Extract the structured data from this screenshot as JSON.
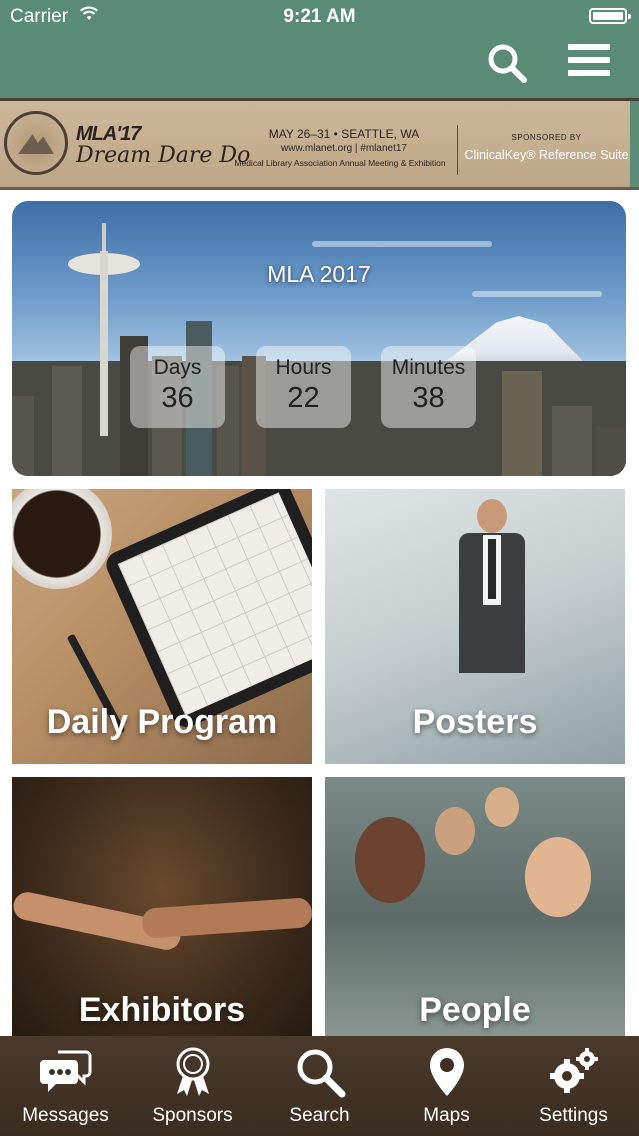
{
  "status_bar": {
    "carrier": "Carrier",
    "time": "9:21 AM"
  },
  "header": {
    "search_icon": "search-icon",
    "menu_icon": "hamburger-menu-icon",
    "background_color": "#5a8b76"
  },
  "banner": {
    "logo_text": "MLA'17",
    "tagline": "Dream Dare Do",
    "date_location": "MAY 26–31 • SEATTLE, WA",
    "url": "www.mlanet.org | #mlanet17",
    "meeting": "Medical Library Association Annual Meeting & Exhibition",
    "sponsored_by": "SPONSORED BY",
    "sponsor": "ClinicalKey® Reference Suite"
  },
  "countdown": {
    "title": "MLA 2017",
    "units": [
      {
        "label": "Days",
        "value": "36"
      },
      {
        "label": "Hours",
        "value": "22"
      },
      {
        "label": "Minutes",
        "value": "38"
      }
    ]
  },
  "tiles": [
    {
      "label": "Daily Program"
    },
    {
      "label": "Posters"
    },
    {
      "label": "Exhibitors"
    },
    {
      "label": "People"
    }
  ],
  "tabbar": {
    "background_color": "#3f3024",
    "items": [
      {
        "label": "Messages",
        "icon": "chat-bubbles-icon"
      },
      {
        "label": "Sponsors",
        "icon": "award-ribbon-icon"
      },
      {
        "label": "Search",
        "icon": "search-icon"
      },
      {
        "label": "Maps",
        "icon": "map-pin-icon"
      },
      {
        "label": "Settings",
        "icon": "gears-icon"
      }
    ]
  }
}
